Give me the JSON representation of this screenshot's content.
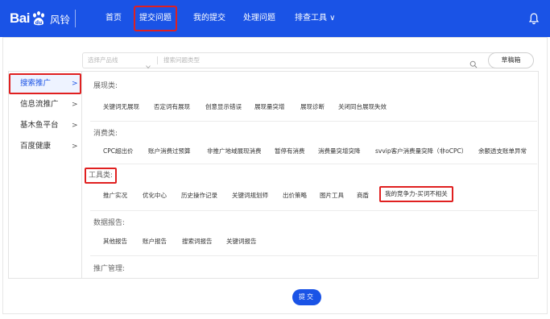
{
  "app": {
    "logo_text": "Bai",
    "name": "风铃"
  },
  "nav": {
    "items": [
      "首页",
      "提交问题",
      "我的提交",
      "处理问题",
      "排查工具 ∨"
    ],
    "active_index": 1
  },
  "filters": {
    "product_placeholder": "选择产品线",
    "type_placeholder": "搜索问题类型",
    "draft_label": "草稿箱"
  },
  "menu": {
    "items": [
      "搜索推广",
      "信息流推广",
      "基木鱼平台",
      "百度健康"
    ],
    "arrow": ">",
    "active_index": 0
  },
  "sections": [
    {
      "title": "展现类:",
      "options": [
        "关键词无展现",
        "否定词有展现",
        "创意显示错误",
        "展现量突增",
        "展现诊断",
        "关闭同台展现失效"
      ]
    },
    {
      "title": "消费类:",
      "options": [
        "CPC超出价",
        "账户消费过预算",
        "非推广地域展现消费",
        "暂停有消费",
        "消费量突增突降",
        "svvip客户消费量突降（非oCPC）",
        "余额透支账单异常"
      ]
    },
    {
      "title": "工具类:",
      "options": [
        "推广实况",
        "优化中心",
        "历史操作记录",
        "关键词规划师",
        "出价策略",
        "图片工具",
        "商盾",
        "我的竞争力-买词不相关"
      ]
    },
    {
      "title": "数据报告:",
      "options": [
        "其他报告",
        "账户报告",
        "搜索词报告",
        "关键词报告"
      ]
    },
    {
      "title": "推广管理:",
      "options": []
    }
  ],
  "submit_label": "提交",
  "colors": {
    "brand": "#1a53e6",
    "highlight": "#e02020"
  }
}
